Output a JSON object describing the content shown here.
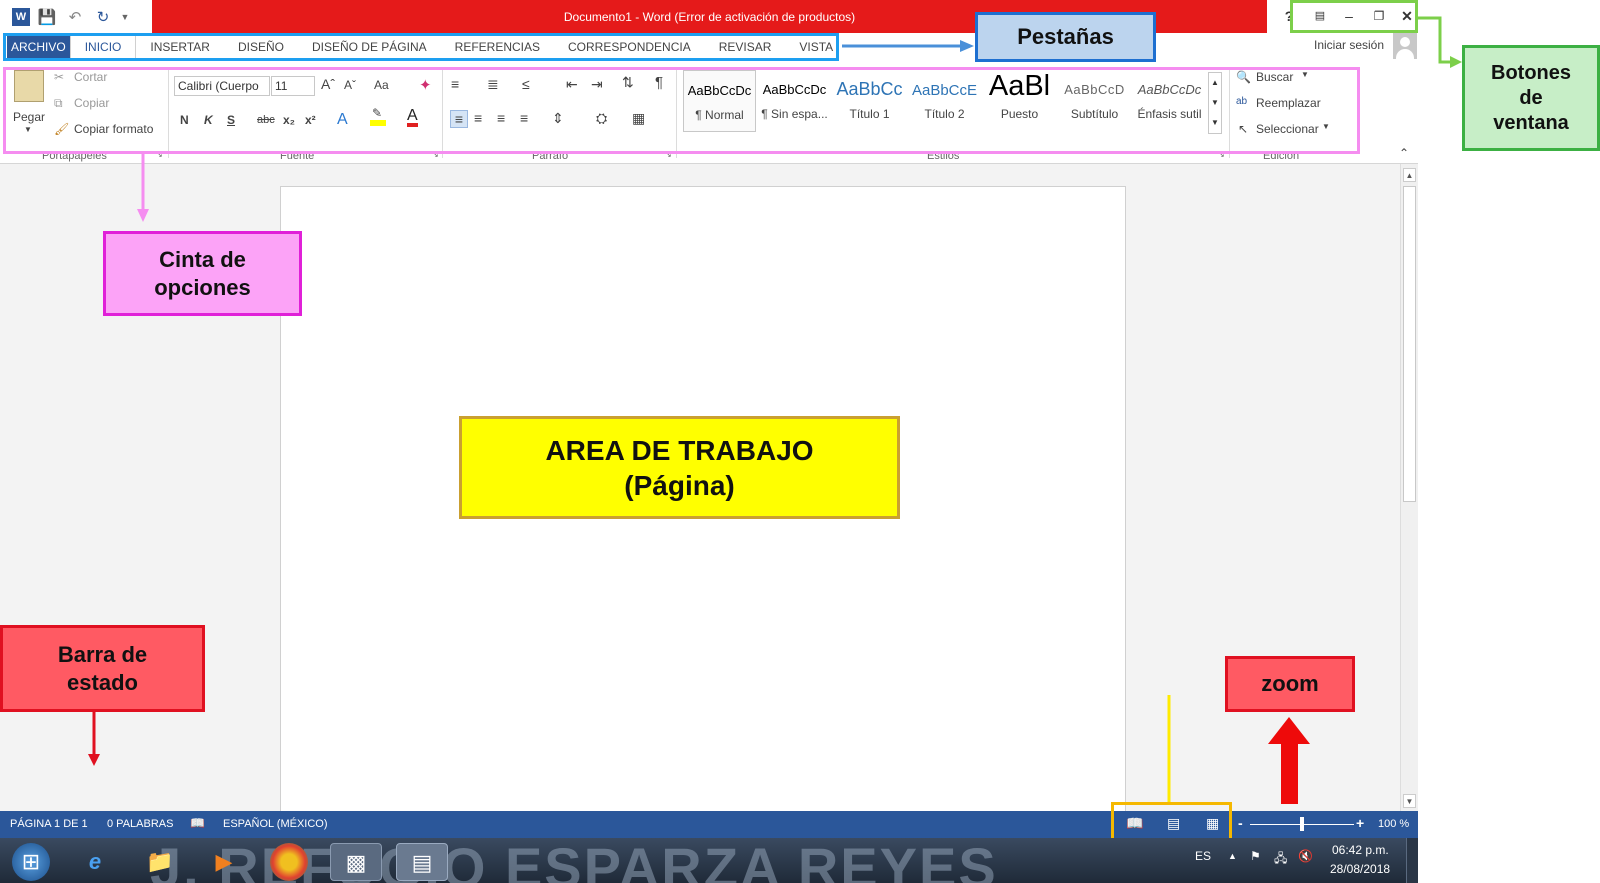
{
  "window": {
    "title": "Documento1 - Word (Error de activación de productos)",
    "help_icon": "?",
    "signin_label": "Iniciar sesión"
  },
  "tabs": [
    {
      "label": "ARCHIVO"
    },
    {
      "label": "INICIO"
    },
    {
      "label": "INSERTAR"
    },
    {
      "label": "DISEÑO"
    },
    {
      "label": "DISEÑO DE PÁGINA"
    },
    {
      "label": "REFERENCIAS"
    },
    {
      "label": "CORRESPONDENCIA"
    },
    {
      "label": "REVISAR"
    },
    {
      "label": "VISTA"
    }
  ],
  "clipboard": {
    "paste": "Pegar",
    "cut": "Cortar",
    "copy": "Copiar",
    "format_painter": "Copiar formato",
    "group": "Portapapeles"
  },
  "font": {
    "family": "Calibri (Cuerpo",
    "size": "11",
    "case": "Aa",
    "bold": "N",
    "italic": "K",
    "underline": "S",
    "strike": "abc",
    "sub": "x₂",
    "sup": "x²",
    "group": "Fuente"
  },
  "paragraph": {
    "group": "Párrafo"
  },
  "styles": {
    "items": [
      {
        "sample": "AaBbCcDc",
        "name": "¶ Normal"
      },
      {
        "sample": "AaBbCcDc",
        "name": "¶ Sin espa..."
      },
      {
        "sample": "AaBbCc",
        "name": "Título 1"
      },
      {
        "sample": "AaBbCcE",
        "name": "Título 2"
      },
      {
        "sample": "AaBl",
        "name": "Puesto"
      },
      {
        "sample": "AaBbCcD",
        "name": "Subtítulo"
      },
      {
        "sample": "AaBbCcDc",
        "name": "Énfasis sutil"
      }
    ],
    "group": "Estilos"
  },
  "editing": {
    "find": "Buscar",
    "replace": "Reemplazar",
    "select": "Seleccionar",
    "group": "Edición"
  },
  "status": {
    "page": "PÁGINA 1 DE 1",
    "words": "0 PALABRAS",
    "language": "ESPAÑOL (MÉXICO)",
    "zoom": "100 %",
    "zoom_level": 1.0
  },
  "taskbar": {
    "watermark": "J. REFUGIO ESPARZA REYES",
    "lang": "ES",
    "time": "06:42 p.m.",
    "date": "28/08/2018"
  },
  "annotations": {
    "pestanas": "Pestañas",
    "botones_line1": "Botones",
    "botones_line2": "de",
    "botones_line3": "ventana",
    "cinta_line1": "Cinta de",
    "cinta_line2": "opciones",
    "area_line1": "AREA DE TRABAJO",
    "area_line2": "(Página)",
    "barra_line1": "Barra de",
    "barra_line2": "estado",
    "zoom": "zoom"
  },
  "colors": {
    "titlebar": "#e51a1a",
    "accent": "#2b579a",
    "tabs_outline": "#1d9ff0",
    "ribbon_outline": "#f58df0",
    "window_buttons_outline": "#7ccf4a",
    "view_buttons_outline": "#f5b800"
  }
}
